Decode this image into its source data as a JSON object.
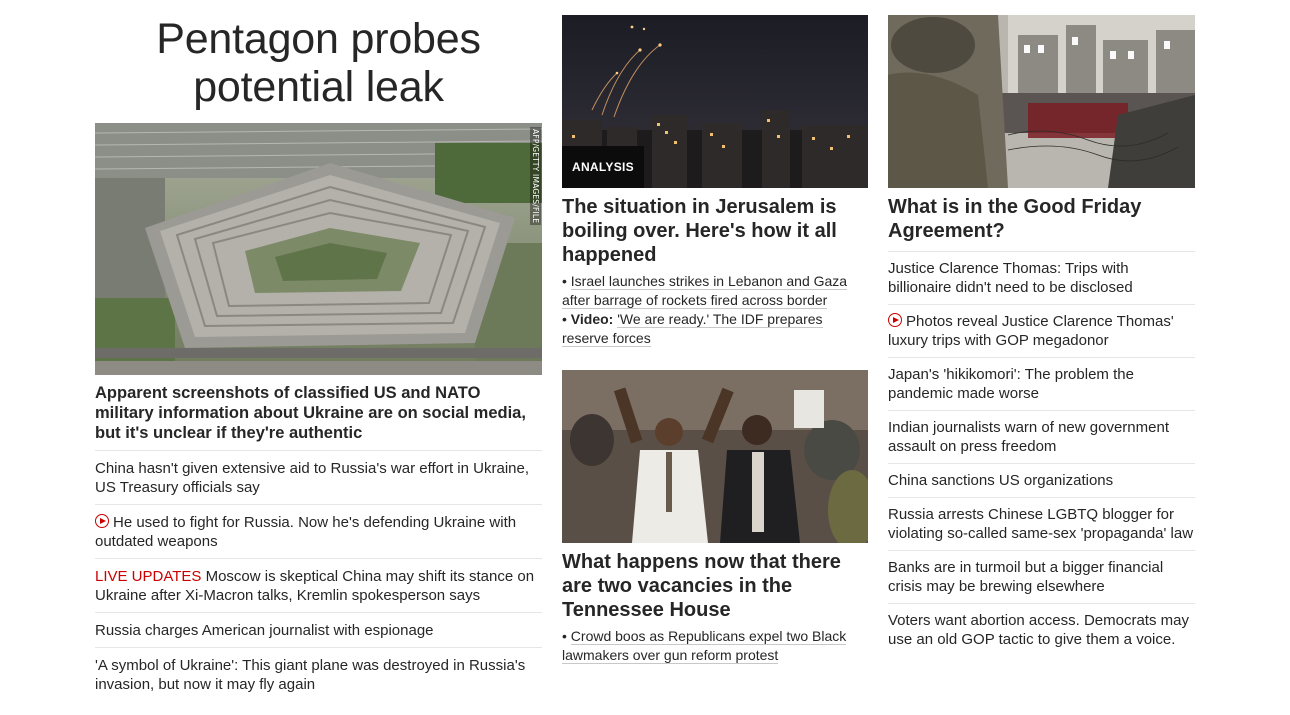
{
  "left": {
    "headline": "Pentagon probes potential leak",
    "image_credit": "AFP/GETTY IMAGES/FILE",
    "lead_text": "Apparent screenshots of classified US and NATO military information about Ukraine are on social media, but it's unclear if they're authentic",
    "stories": [
      {
        "text": "China hasn't given extensive aid to Russia's war effort in Ukraine, US Treasury officials say"
      },
      {
        "text": "He used to fight for Russia. Now he's defending Ukraine with outdated weapons",
        "icon": "play-icon"
      },
      {
        "label": "LIVE UPDATES",
        "text": "Moscow is skeptical China may shift its stance on Ukraine after Xi-Macron talks, Kremlin spokesperson says"
      },
      {
        "text": "Russia charges American journalist with espionage"
      },
      {
        "text": "'A symbol of Ukraine': This giant plane was destroyed in Russia's invasion, but now it may fly again"
      }
    ]
  },
  "middle": {
    "card1": {
      "badge": "ANALYSIS",
      "headline": "The situation in Jerusalem is boiling over. Here's how it all happened",
      "bullet1": "Israel launches strikes in Lebanon and Gaza after barrage of rockets fired across border",
      "bullet2_label": "Video:",
      "bullet2": "'We are ready.' The IDF prepares reserve forces"
    },
    "card2": {
      "headline": "What happens now that there are two vacancies in the Tennessee House",
      "bullet1": "Crowd boos as Republicans expel two Black lawmakers over gun reform protest"
    }
  },
  "right": {
    "headline": "What is in the Good Friday Agreement?",
    "stories": [
      {
        "text": "Justice Clarence Thomas: Trips with billionaire didn't need to be disclosed"
      },
      {
        "text": "Photos reveal Justice Clarence Thomas' luxury trips with GOP megadonor",
        "icon": "play-icon"
      },
      {
        "text": "Japan's 'hikikomori': The problem the pandemic made worse"
      },
      {
        "text": "Indian journalists warn of new government assault on press freedom"
      },
      {
        "text": "China sanctions US organizations"
      },
      {
        "text": "Russia arrests Chinese LGBTQ blogger for violating so-called same-sex 'propaganda' law"
      },
      {
        "text": "Banks are in turmoil but a bigger financial crisis may be brewing elsewhere"
      },
      {
        "text": "Voters want abortion access. Democrats may use an old GOP tactic to give them a voice."
      }
    ]
  },
  "colors": {
    "live": "#cc0000",
    "text": "#262626",
    "divider": "#e6e6e6",
    "badge_bg": "#0c0c0c"
  }
}
